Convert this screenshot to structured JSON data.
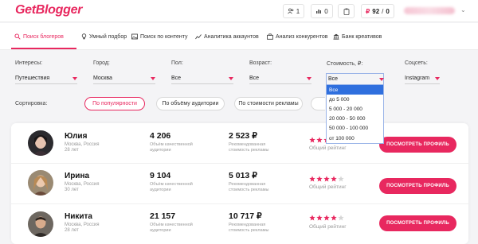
{
  "header": {
    "logo": "GetBlogger",
    "people_count": "1",
    "stats_count": "0",
    "balance_value": "92",
    "balance_sep": "/",
    "balance_zero": "0",
    "rub_symbol": "₽"
  },
  "nav": {
    "items": [
      {
        "label": "Поиск блогеров",
        "icon": "search-icon"
      },
      {
        "label": "Умный подбор",
        "icon": "bulb-icon"
      },
      {
        "label": "Поиск по контенту",
        "icon": "image-icon"
      },
      {
        "label": "Аналитика аккаунтов",
        "icon": "chart-icon"
      },
      {
        "label": "Анализ конкурентов",
        "icon": "briefcase-icon"
      },
      {
        "label": "Банк креативов",
        "icon": "bank-icon"
      }
    ]
  },
  "filters": {
    "interests": {
      "label": "Интересы:",
      "value": "Путешествия"
    },
    "city": {
      "label": "Город:",
      "value": "Москва"
    },
    "gender": {
      "label": "Пол:",
      "value": "Все"
    },
    "age": {
      "label": "Возраст:",
      "value": "Все"
    },
    "cost": {
      "label": "Стоимость, ₽:",
      "value": "Все"
    },
    "social": {
      "label": "Соцсеть:",
      "value": "Instagram"
    }
  },
  "cost_options": [
    "Все",
    "до 5 000",
    "5 000 - 20 000",
    "20 000 - 50 000",
    "50 000 - 100 000",
    "от 100 000"
  ],
  "sort": {
    "label": "Сортировка:",
    "options": [
      "По популярности",
      "По объёму аудитории",
      "По стоимости рекламы"
    ]
  },
  "bloggers": [
    {
      "name": "Юлия",
      "location": "Москва, Россия",
      "age": "28 лет",
      "audience": "4 206",
      "price": "2 523 ₽",
      "stars": 4
    },
    {
      "name": "Ирина",
      "location": "Москва, Россия",
      "age": "30 лет",
      "audience": "9 104",
      "price": "5 013 ₽",
      "stars": 4
    },
    {
      "name": "Никита",
      "location": "Москва, Россия",
      "age": "28 лет",
      "audience": "21 157",
      "price": "10 717 ₽",
      "stars": 4
    }
  ],
  "labels": {
    "audience_desc_1": "Объём качественной",
    "audience_desc_2": "аудитории",
    "price_desc_1": "Рекомендованная",
    "price_desc_2": "стоимость рекламы",
    "rating": "Общий рейтинг",
    "profile_button": "ПОСМОТРЕТЬ ПРОФИЛЬ"
  },
  "colors": {
    "accent": "#e8285f",
    "selected_option": "#2f6fde",
    "star": "#e8285f"
  }
}
